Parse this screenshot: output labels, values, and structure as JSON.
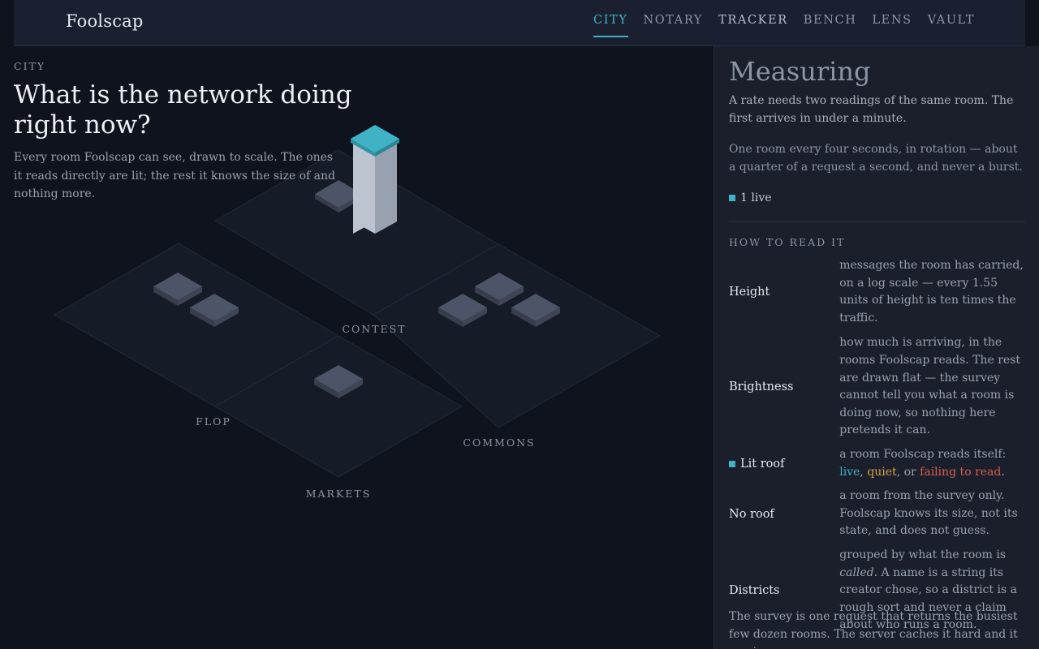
{
  "app": {
    "brand": "Foolscap",
    "nav": [
      {
        "label": "CITY",
        "active": true
      },
      {
        "label": "NOTARY"
      },
      {
        "label": "TRACKER"
      },
      {
        "label": "BENCH"
      },
      {
        "label": "LENS"
      },
      {
        "label": "VAULT"
      }
    ]
  },
  "main": {
    "kicker": "CITY",
    "headline": "What is the network doing right now?",
    "lede": "Every room Foolscap can see, drawn to scale. The ones it reads directly are lit; the rest it knows the size of and nothing more."
  },
  "map": {
    "districts": [
      "CONTEST",
      "FLOP",
      "COMMONS",
      "MARKETS"
    ]
  },
  "side": {
    "title": "Measuring",
    "p1": "A rate needs two readings of the same room. The first arrives in under a minute.",
    "p2": "One room every four seconds, in rotation — about a quarter of a request a second, and never a burst.",
    "live_count": "1 live",
    "how_heading": "HOW TO READ IT",
    "legend": {
      "height_term": "Height",
      "height_desc": "messages the room has carried, on a log scale — every 1.55 units of height is ten times the traffic.",
      "brightness_term": "Brightness",
      "brightness_desc": "how much is arriving, in the rooms Foolscap reads. The rest are drawn flat — the survey cannot tell you what a room is doing now, so nothing here pretends it can.",
      "litroof_term": "Lit roof",
      "litroof_pre": "a room Foolscap reads itself: ",
      "litroof_live": "live",
      "litroof_sep1": ", ",
      "litroof_quiet": "quiet",
      "litroof_sep2": ", or ",
      "litroof_fail": "failing to read",
      "litroof_end": ".",
      "noroof_term": "No roof",
      "noroof_desc": "a room from the survey only. Foolscap knows its size, not its state, and does not guess.",
      "districts_term": "Districts",
      "districts_pre": "grouped by what the room is ",
      "districts_em": "called",
      "districts_post": ". A name is a string its creator chose, so a district is a rough sort and never a claim about who runs a room."
    },
    "closing": "The survey is one request that returns the busiest few dozen rooms. The server caches it hard and it carries no"
  },
  "colors": {
    "accent": "#3fb3c5",
    "quiet": "#d7a542",
    "failing": "#d9604f",
    "background": "#0e131d",
    "panel": "#1a1f2b"
  }
}
